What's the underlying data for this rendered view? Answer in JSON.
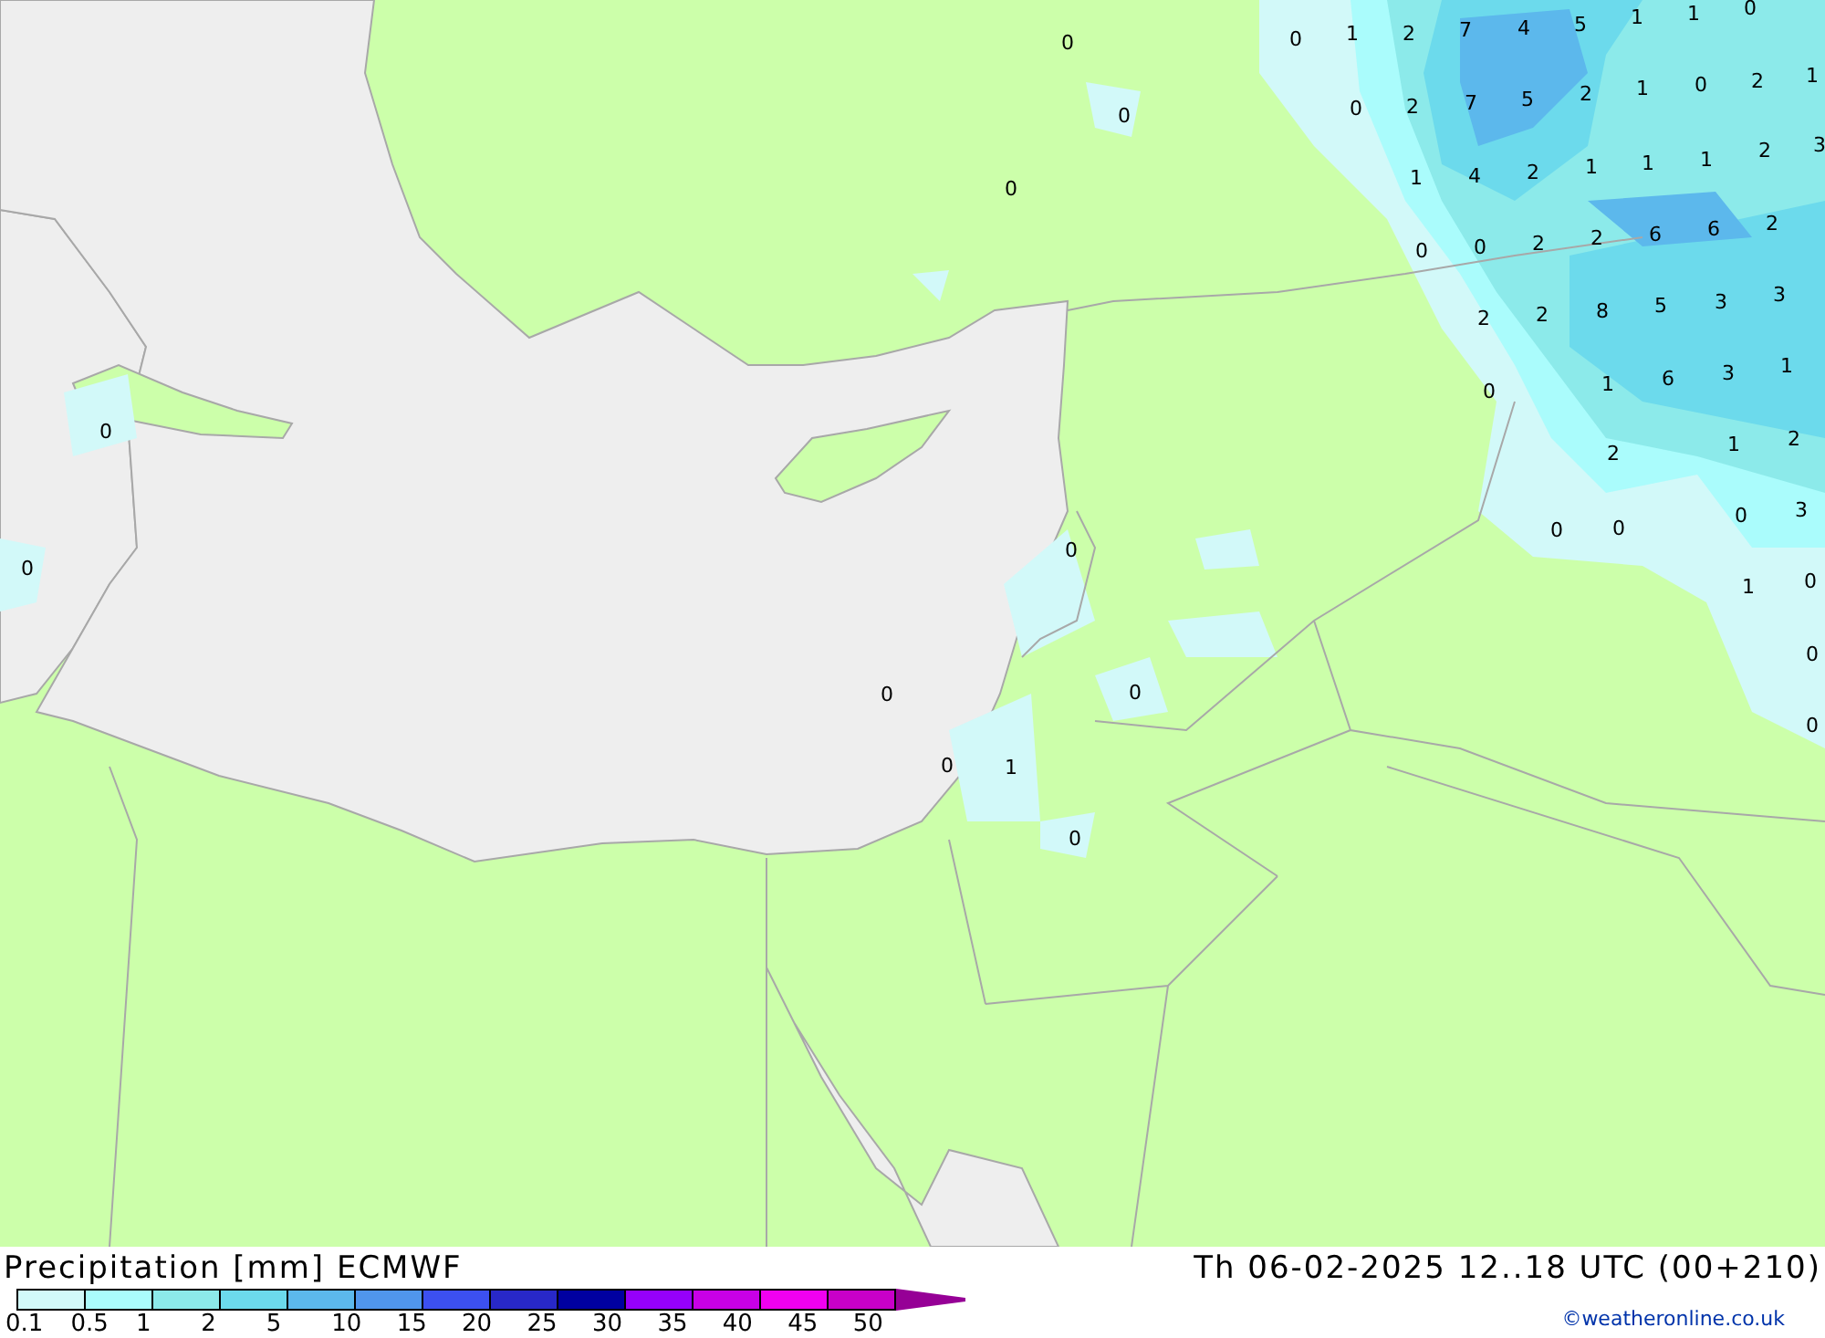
{
  "map": {
    "value_labels": [
      "0",
      "1",
      "2",
      "7",
      "4",
      "5",
      "1",
      "1",
      "0",
      "0",
      "2",
      "7",
      "5",
      "2",
      "1",
      "0",
      "2",
      "1",
      "1",
      "4",
      "2",
      "1",
      "1",
      "1",
      "2",
      "3",
      "0",
      "0",
      "2",
      "2",
      "6",
      "6",
      "2",
      "2",
      "2",
      "8",
      "5",
      "3",
      "3",
      "0",
      "1",
      "6",
      "3",
      "1",
      "2",
      "1",
      "2",
      "0",
      "0",
      "0",
      "3",
      "1",
      "0",
      "0",
      "0",
      "0",
      "0",
      "0",
      "0",
      "0",
      "0",
      "0",
      "0",
      "0",
      "1",
      "0"
    ]
  },
  "footer": {
    "title": "Precipitation [mm] ECMWF",
    "valid_time": "Th 06-02-2025 12..18 UTC (00+210)",
    "credit": "©weatheronline.co.uk",
    "legend": [
      {
        "color": "#d2f9f9"
      },
      {
        "color": "#aafcfc"
      },
      {
        "color": "#8ceaea"
      },
      {
        "color": "#6cdaec"
      },
      {
        "color": "#5cb8ec"
      },
      {
        "color": "#5096ec"
      },
      {
        "color": "#3c50f0"
      },
      {
        "color": "#2828c8"
      },
      {
        "color": "#0000a0"
      },
      {
        "color": "#9600fa"
      },
      {
        "color": "#c800e6"
      },
      {
        "color": "#f000f0"
      },
      {
        "color": "#c800c8"
      }
    ],
    "legend_labels": [
      "0.1",
      "0.5",
      "1",
      "2",
      "5",
      "10",
      "15",
      "20",
      "25",
      "30",
      "35",
      "40",
      "45",
      "50"
    ]
  }
}
